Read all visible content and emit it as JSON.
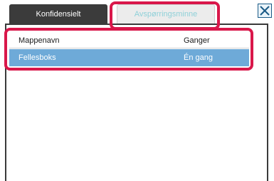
{
  "tabs": {
    "confidential_label": "Konfidensielt",
    "history_label": "Avspørringsminne"
  },
  "close_icon": "close-x-icon",
  "table": {
    "header": {
      "folder_name": "Mappenavn",
      "times": "Ganger"
    },
    "rows": [
      {
        "folder_name": "Fellesboks",
        "times": "Én gang",
        "selected": true
      }
    ]
  },
  "colors": {
    "highlight": "#d9174a",
    "selected_row": "#6eaad8",
    "active_tab_text": "#8fd0d8",
    "dark_tab": "#3b3b3b"
  }
}
